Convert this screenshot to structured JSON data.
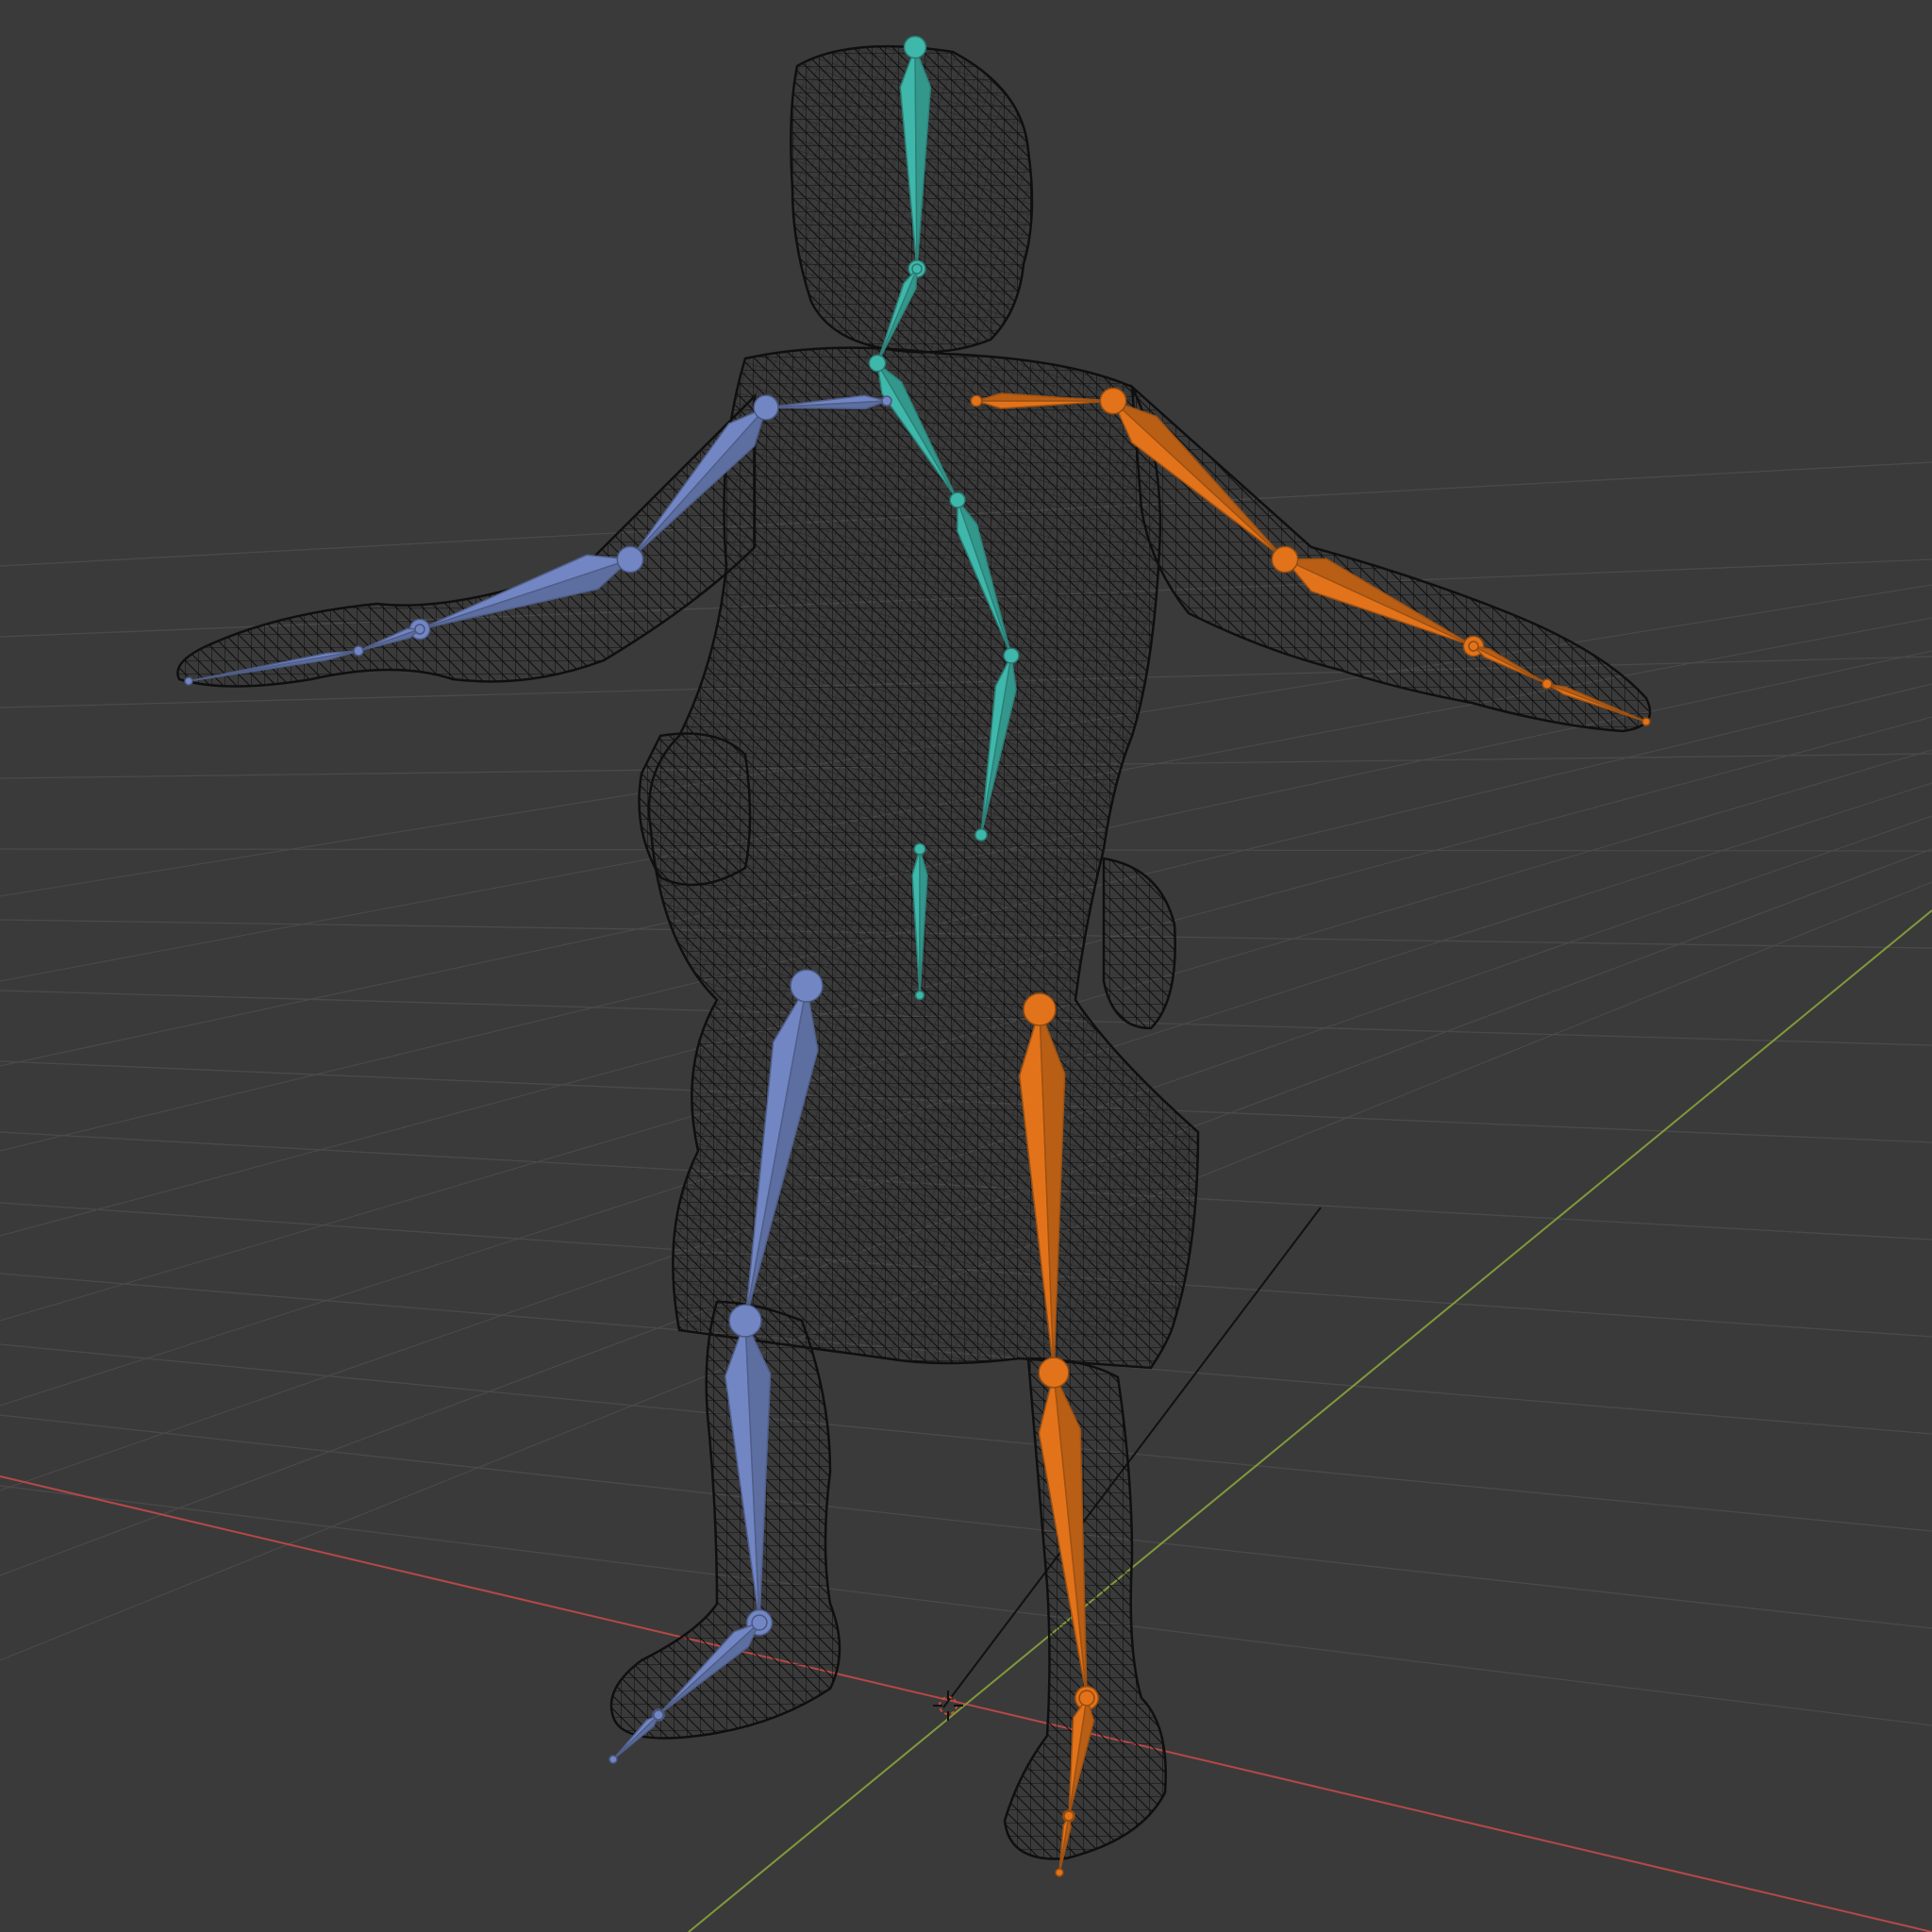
{
  "viewport": {
    "view": "3D Viewport",
    "shading": "wireframe",
    "background_color": "#3a3a3a",
    "grid_color": "#4a4a4a",
    "x_axis_color": "#b54848",
    "y_axis_color": "#7f9a3a"
  },
  "mesh": {
    "name": "character-mesh",
    "display": "wireframe",
    "wire_color": "#0d0d0d"
  },
  "armature": {
    "name": "armature",
    "display": "octahedral",
    "colors": {
      "center_chain": "#3fb8ab",
      "right_side": "#7286c4",
      "left_side": "#e2731a"
    },
    "bones": [
      "head",
      "neck",
      "spine-upper",
      "spine-mid",
      "spine-lower",
      "spine-root",
      "pelvis",
      "shoulder-r",
      "upper-arm-r",
      "forearm-r",
      "hand-r",
      "shoulder-l",
      "upper-arm-l",
      "forearm-l",
      "hand-l",
      "thigh-r",
      "shin-r",
      "foot-r",
      "toe-r",
      "thigh-l",
      "shin-l",
      "foot-l",
      "toe-l"
    ]
  },
  "scene": {
    "origin_marker": "3d-cursor",
    "camera_line": "relationship-line"
  }
}
